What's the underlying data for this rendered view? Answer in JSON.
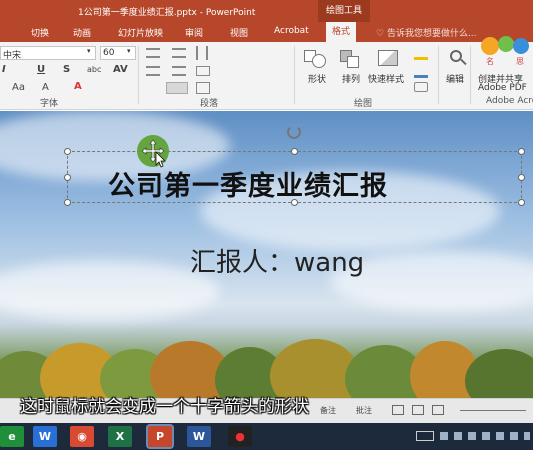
{
  "window": {
    "title": "1公司第一季度业绩汇报.pptx - PowerPoint",
    "context_tab": "绘图工具"
  },
  "tabs": [
    {
      "label": "切换"
    },
    {
      "label": "动画"
    },
    {
      "label": "幻灯片放映"
    },
    {
      "label": "审阅"
    },
    {
      "label": "视图"
    },
    {
      "label": "Acrobat"
    },
    {
      "label": "格式",
      "active": true
    }
  ],
  "tell_me": "告诉我您想要做什么...",
  "ribbon": {
    "font_name": "中宋",
    "font_size": "60",
    "format_glyphs": [
      "I",
      "U",
      "S",
      "abc",
      "AV",
      "Aa",
      "A",
      "A"
    ],
    "groups": {
      "font": "字体",
      "paragraph": "段落",
      "drawing": "绘图",
      "adobe": "Adobe Acro"
    },
    "drawing_buttons": [
      "形状",
      "排列",
      "快速样式"
    ],
    "edit_button": "编辑",
    "adobe_button_line1": "创建并共享",
    "adobe_button_line2": "Adobe PDF"
  },
  "slide": {
    "title": "公司第一季度业绩汇报",
    "subtitle": "汇报人：wang"
  },
  "caption": "这时鼠标就会变成一个十字箭头的形状",
  "status": {
    "notes": "备注",
    "comments": "批注"
  },
  "taskbar": {
    "apps": [
      {
        "icon": "e-icon",
        "glyph": "e",
        "color": "#1f8f3a"
      },
      {
        "icon": "wps-icon",
        "glyph": "W",
        "color": "#2a6fd6"
      },
      {
        "icon": "chrome-icon",
        "glyph": "◉",
        "color": "#d94a32"
      },
      {
        "icon": "excel-icon",
        "glyph": "X",
        "color": "#1e7145"
      },
      {
        "icon": "powerpoint-icon",
        "glyph": "P",
        "color": "#c5462b"
      },
      {
        "icon": "word-icon",
        "glyph": "W",
        "color": "#2b579a"
      },
      {
        "icon": "record-icon",
        "glyph": "●",
        "color": "#222222"
      }
    ]
  },
  "colors": {
    "accent": "#b7472a",
    "taskbar": "#1c2a3c"
  }
}
